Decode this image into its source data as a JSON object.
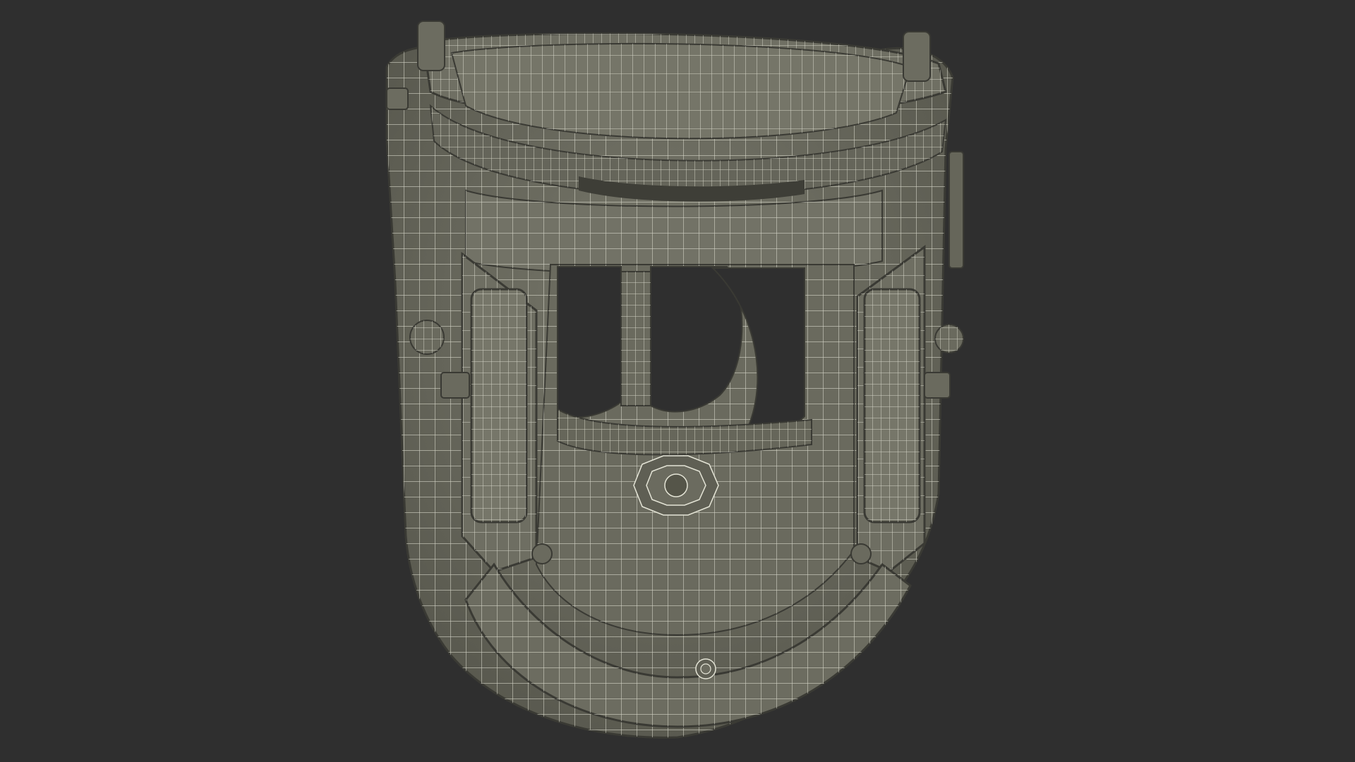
{
  "scene": {
    "background_color": "#2f2f2f",
    "model_fill": "#6b6b5f",
    "model_fill_dark": "#5a5a50",
    "model_fill_light": "#7a7a6d",
    "wire_color": "#e4e4d6",
    "edge_color": "#3a3a34",
    "opening_color": "#2f2f2f"
  }
}
